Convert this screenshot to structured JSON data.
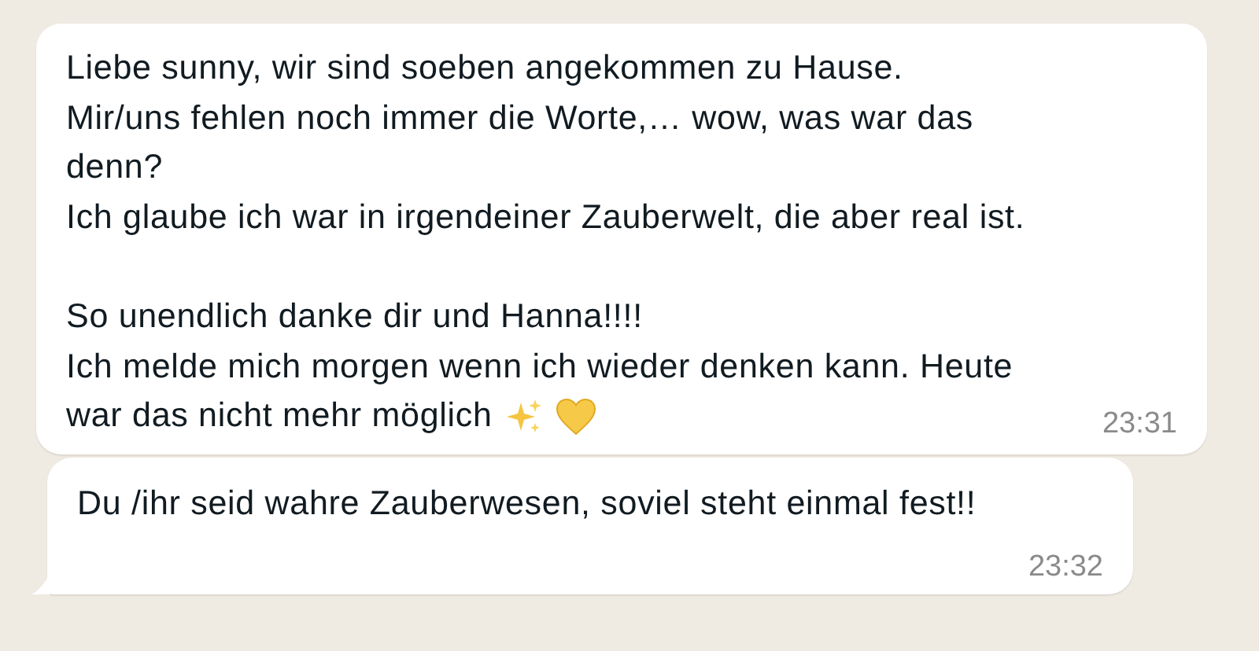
{
  "messages": [
    {
      "paragraphs": [
        [
          "Liebe sunny, wir sind soeben angekommen zu Hause.",
          "Mir/uns fehlen noch immer die Worte,… wow, was war das",
          "denn?",
          "Ich glaube ich war in irgendeiner Zauberwelt, die aber real ist."
        ],
        [
          "So unendlich danke dir und Hanna!!!!",
          "Ich melde mich morgen wenn ich wieder denken kann. Heute",
          "war das nicht mehr möglich"
        ]
      ],
      "trailing_icons": [
        {
          "kind": "sparkles"
        },
        {
          "kind": "heart"
        }
      ],
      "time": "23:31",
      "tail": false
    },
    {
      "paragraphs": [
        [
          "Du /ihr seid wahre Zauberwesen, soviel steht einmal fest!!"
        ]
      ],
      "time": "23:32",
      "tail": true
    }
  ]
}
